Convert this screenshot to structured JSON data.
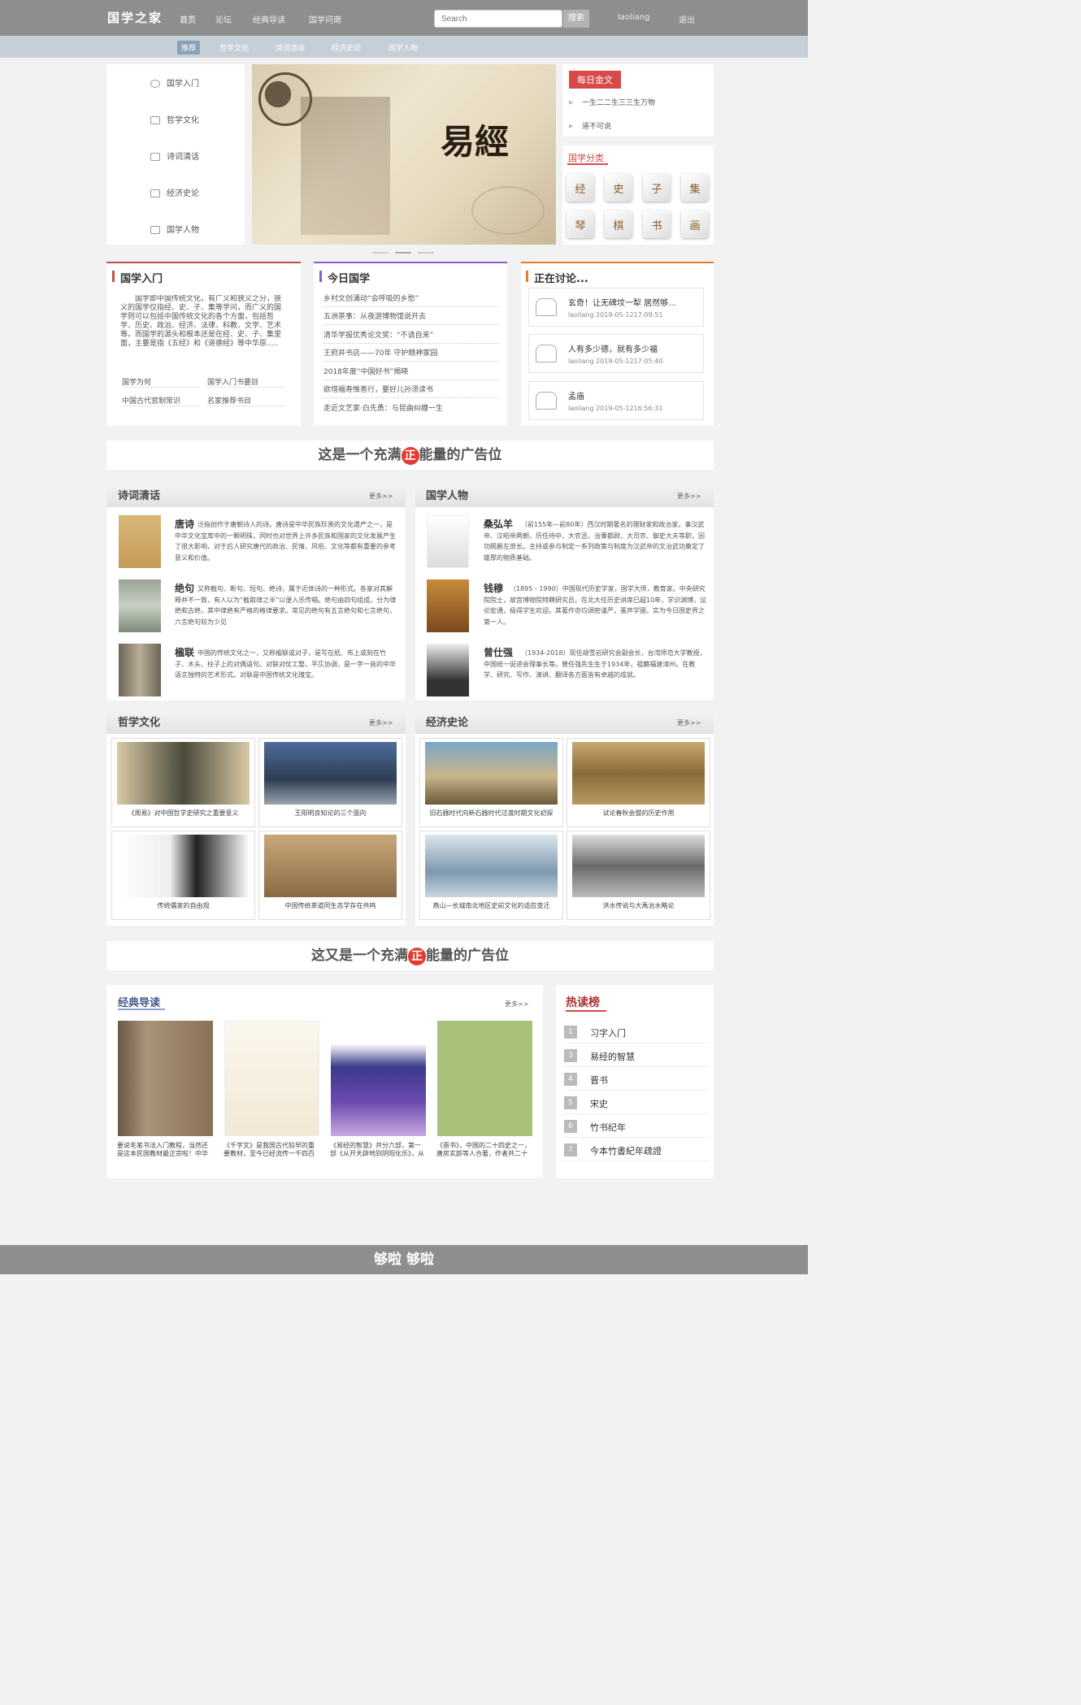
{
  "nav": {
    "logo": "国学之家",
    "links": [
      "首页",
      "论坛",
      "经典导读",
      "国学问南"
    ],
    "search_placeholder": "Search",
    "search_btn": "搜索",
    "user": "laoliang",
    "logout": "退出"
  },
  "subnav": [
    "推荐",
    "哲学文化",
    "诗词清话",
    "经济史论",
    "国学人物"
  ],
  "sidebar": [
    "国学入门",
    "哲学文化",
    "诗词清话",
    "经济史论",
    "国学人物"
  ],
  "banner": {
    "title": "易經"
  },
  "daily": {
    "tag": "每日金文",
    "items": [
      "一生二二生三三生万物",
      "道不可说"
    ]
  },
  "categories": {
    "title": "国学分类",
    "icons": [
      "经",
      "史",
      "子",
      "集",
      "琴",
      "棋",
      "书",
      "画"
    ]
  },
  "intro": {
    "title": "国学入门",
    "text": "国学即中国传统文化，有广义和狭义之分，狭义的国学仅指经、史、子、集等学问，而广义的国学则可以包括中国传统文化的各个方面，包括哲学、历史、政治、经济、法律、科教、文学、艺术等。而国学的源头和根本还是在经、史、子、集里面，主要是指《五经》和《道德经》等中华原.....",
    "links": [
      "国学为何",
      "国学入门书要目",
      "中国古代官制常识",
      "名家推荐书目"
    ]
  },
  "today": {
    "title": "今日国学",
    "items": [
      "乡村文创涌动“会呼吸的乡愁”",
      "五洲茶事：从夜游博物馆说开去",
      "清华学报优秀论文奖：“不请自来”",
      "王府井书店——70年 守护精神家园",
      "2018年度“中国好书”揭晓",
      "欲增福寿惟善行，要好儿孙须读书",
      "走近文艺家·白先勇：与昆曲纠缠一生"
    ]
  },
  "discuss": {
    "title": "正在讨论...",
    "items": [
      {
        "title": "玄奇！让无碑坟一犁 居然够...",
        "meta": "laoliang   2019-05-1217:09:51"
      },
      {
        "title": "人有多少德，就有多少福",
        "meta": "laoliang   2019-05-1217:05:40"
      },
      {
        "title": "孟庙",
        "meta": "laoliang   2019-05-1216:56:31"
      }
    ]
  },
  "ads": [
    "这是一个充满",
    "能量的广告位",
    "这又是一个充满",
    "正"
  ],
  "poetry": {
    "title": "诗词清话",
    "more": "更多>>",
    "items": [
      {
        "name": "唐诗",
        "text": "泛指创作于唐朝诗人的诗。唐诗是中华民族珍贵的文化遗产之一，是中华文化宝库中的一颗明珠，同时也对世界上许多民族和国家的文化发展产生了很大影响，对于后人研究唐代的政治、民情、风俗、文化等都有重要的参考意义和价值。"
      },
      {
        "name": "绝句",
        "text": "又称截句、断句、短句、绝诗，属于近体诗的一种形式。各家对其解释并不一致，有人以为“截取律之半”以便入乐传唱。绝句由四句组成，分为律绝和古绝，其中律绝有严格的格律要求。常见的绝句有五言绝句和七言绝句，六言绝句较为少见"
      },
      {
        "name": "楹联",
        "text": "中国的传统文化之一，又称楹联或对子，是写在纸、布上或刻在竹子、木头、柱子上的对偶语句。对联对仗工整，平仄协调，是一字一音的中华语言独特的艺术形式。对联是中国传统文化瑰宝。"
      }
    ]
  },
  "people": {
    "title": "国学人物",
    "more": "更多>>",
    "items": [
      {
        "name": "桑弘羊",
        "text": "（前155年—前80年）西汉时期著名的理财家和政治家。事汉武帝、汉昭帝两朝，历任侍中、大农丞、治粟都尉、大司农、御史大夫等职，因功赐爵左庶长。主持或参与制定一系列政策与制度为汉武帝的文治武功奠定了雄厚的物质基础。"
      },
      {
        "name": "钱穆",
        "text": "（1895 - 1990）中国现代历史学家，国学大师，教育家。中央研究院院士，故宫博物院特聘研究员。在北大任历史讲席已超10年，学识渊博，议论宏通，极得学生欢迎。其著作亦均调密谨严，蜚声学圃，实为今日国史界之第一人。"
      },
      {
        "name": "曾仕强",
        "text": "（1934-2018）现任胡雪岩研究会副会长，台湾师范大学教授，中国统一促进会理事长等。曾任强先生生于1934年，祖籍福建漳州。在教学、研究、写作、演讲、翻译各方面皆有卓越的成就。"
      }
    ]
  },
  "philosophy": {
    "title": "哲学文化",
    "more": "更多>>",
    "items": [
      "《周易》对中国哲学史研究之重要意义",
      "王阳明良知论的三个面向",
      "传统儒家的自由观",
      "中国传统茶道同生态学存在共鸣"
    ]
  },
  "economy": {
    "title": "经济史论",
    "more": "更多>>",
    "items": [
      "旧石器时代向新石器时代过渡时期文化初探",
      "试论春秋会盟的历史作用",
      "燕山—长城南北地区史前文化的适应变迁",
      "洪水传说与大禹治水略论"
    ]
  },
  "classics": {
    "title": "经典导读",
    "more": "更多>>",
    "items": [
      "要说毛笔书法入门教程，当然还是这本民国教材最正宗啦！中华书局版《习字入门》",
      "《千字文》是我国古代较早的重要教材，至今已经流传一千四百余年，其知识点涵括...",
      "《易经的智慧》共分六部，第一部《从开天辟地到阴阳化乐》，从乾坤定位开始展开...",
      "《晋书》，中国的二十四史之一，唐房玄龄等人合著，作者共二十一人。记载的历..."
    ]
  },
  "ranking": {
    "title": "热读榜",
    "items": [
      {
        "n": "1",
        "label": "习字入门"
      },
      {
        "n": "3",
        "label": "易经的智慧"
      },
      {
        "n": "4",
        "label": "晋书"
      },
      {
        "n": "5",
        "label": "宋史"
      },
      {
        "n": "6",
        "label": "竹书纪年"
      },
      {
        "n": "7",
        "label": "今本竹書紀年疏證"
      }
    ]
  },
  "footer": "够啦 够啦",
  "colors": {
    "nav": "#8e8e8e",
    "red": "#d84a4a",
    "purple": "#8e5bd0",
    "orange": "#e87b2e"
  }
}
